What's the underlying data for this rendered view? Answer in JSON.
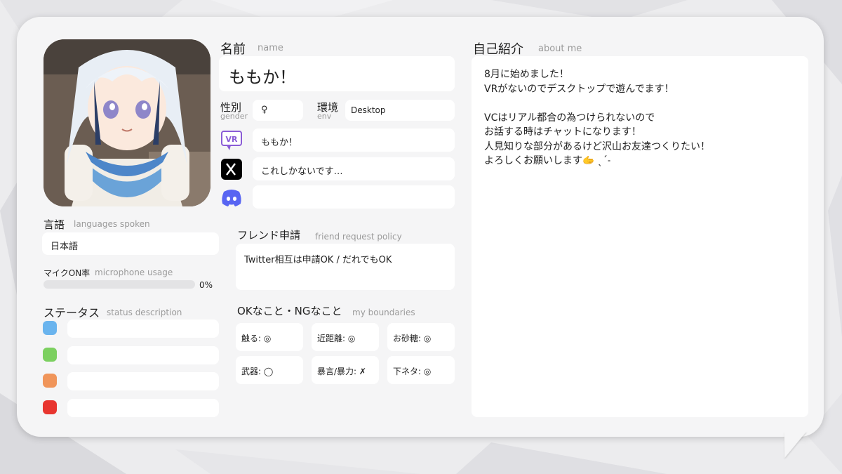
{
  "name": {
    "label": "名前",
    "label_en": "name",
    "value": "ももか！"
  },
  "gender": {
    "label": "性別",
    "label_en": "gender",
    "value": "♀"
  },
  "env": {
    "label": "環境",
    "label_en": "env",
    "value": "Desktop"
  },
  "social": {
    "vrchat": {
      "icon": "vrchat-icon",
      "value": "ももか！"
    },
    "x": {
      "icon": "x-icon",
      "value": "これしかないです…"
    },
    "discord": {
      "icon": "discord-icon",
      "value": ""
    }
  },
  "languages": {
    "label": "言語",
    "label_en": "languages spoken",
    "value": "日本語"
  },
  "mic": {
    "label": "マイクON率",
    "label_en": "microphone usage",
    "percent": 0,
    "percent_text": "0%"
  },
  "status": {
    "label": "ステータス",
    "label_en": "status description",
    "items": [
      {
        "color": "#6ab4ee",
        "text": ""
      },
      {
        "color": "#7cd060",
        "text": ""
      },
      {
        "color": "#f0955a",
        "text": ""
      },
      {
        "color": "#e8352f",
        "text": ""
      }
    ]
  },
  "friend": {
    "label": "フレンド申請",
    "label_en": "friend request policy",
    "value": "Twitter相互は申請OK / だれでもOK"
  },
  "boundaries": {
    "label": "OKなこと・NGなこと",
    "label_en": "my boundaries",
    "items": [
      "触る: ◎",
      "近距離: ◎",
      "お砂糖: ◎",
      "武器: ◯",
      "暴言/暴力: ✗",
      "下ネタ: ◎"
    ]
  },
  "about": {
    "label": "自己紹介",
    "label_en": "about me",
    "lines": [
      "8月に始めました！",
      "VRがないのでデスクトップで遊んでます！",
      "",
      "VCはリアル都合の為つけられないので",
      "お話する時はチャットになります！",
      "人見知りな部分があるけど沢山お友達つくりたい！",
      "よろしくお願いします🫱 ˎˊ˗"
    ]
  },
  "colors": {
    "accent": "#9dc9ee",
    "discord": "#5865f2",
    "vrchat": "#8a5cd6"
  }
}
